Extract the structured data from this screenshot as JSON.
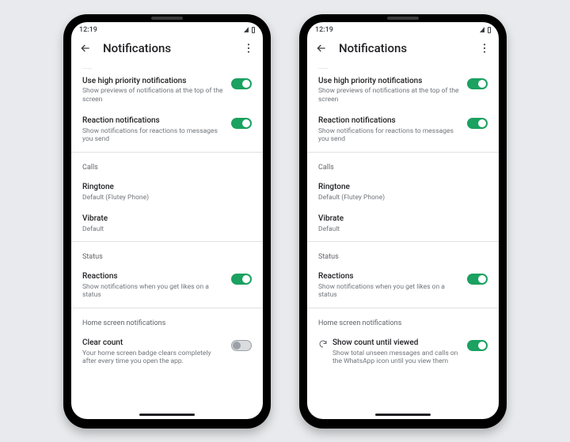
{
  "status_time": "12:19",
  "screen_title": "Notifications",
  "truncated_label": "......",
  "sections": {
    "high_priority": {
      "title": "Use high priority notifications",
      "sub": "Show previews of notifications at the top of the screen"
    },
    "reaction_notifs": {
      "title": "Reaction notifications",
      "sub": "Show notifications for reactions to messages you send"
    },
    "calls_header": "Calls",
    "ringtone": {
      "title": "Ringtone",
      "sub": "Default (Flutey Phone)"
    },
    "vibrate": {
      "title": "Vibrate",
      "sub": "Default"
    },
    "status_header": "Status",
    "status_reactions": {
      "title": "Reactions",
      "sub": "Show notifications when you get likes on a status"
    },
    "home_header": "Home screen notifications",
    "left_home": {
      "title": "Clear count",
      "sub": "Your home screen badge clears completely after every time you open the app."
    },
    "right_home": {
      "title": "Show count until viewed",
      "sub": "Show total unseen messages and calls on the WhatsApp icon until you view them"
    }
  }
}
